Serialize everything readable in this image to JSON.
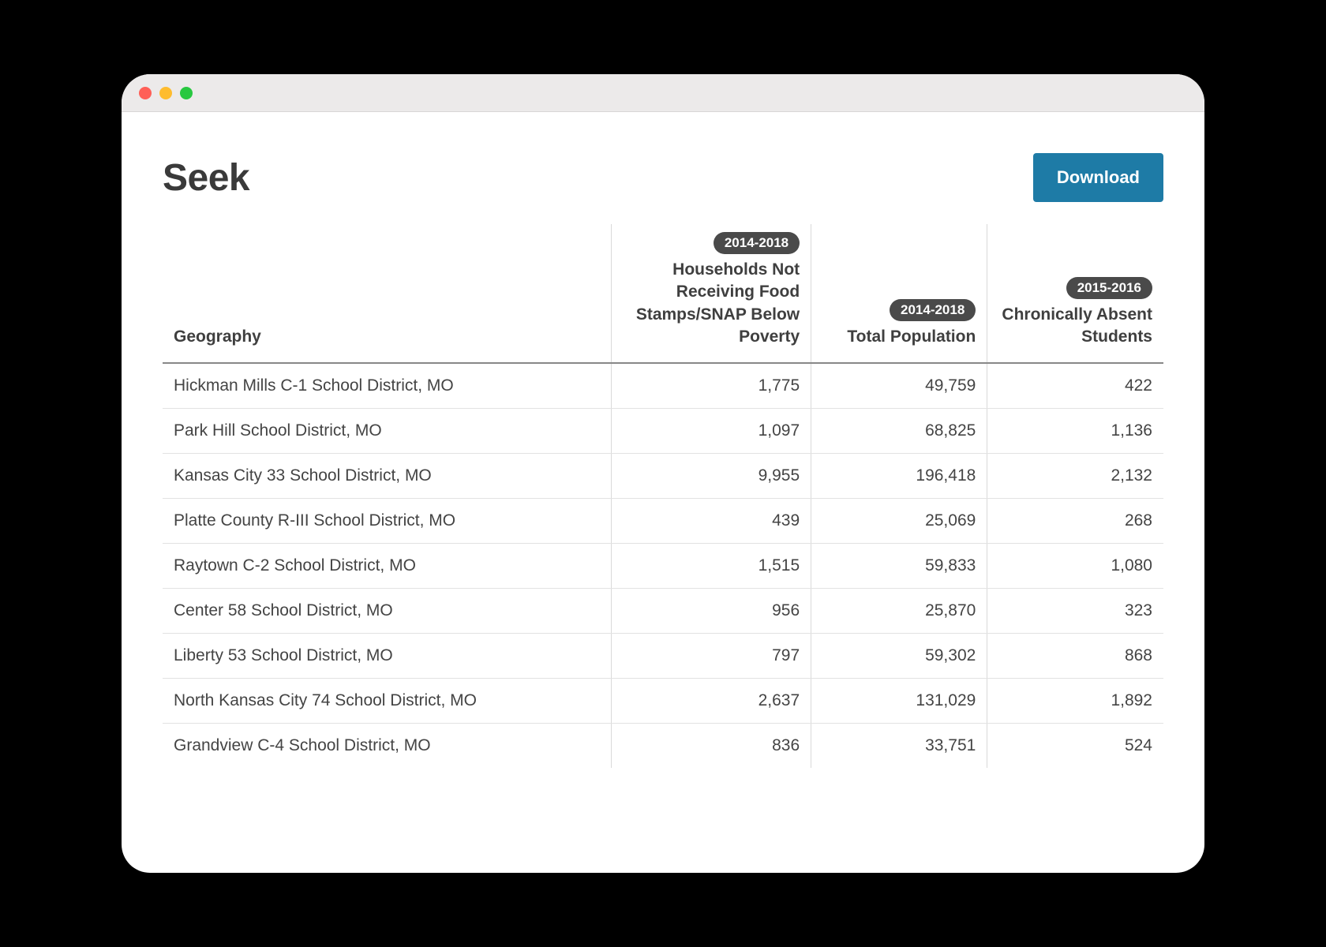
{
  "page_title": "Seek",
  "download_label": "Download",
  "columns": [
    {
      "key": "geo",
      "year": null,
      "label": "Geography",
      "align": "left"
    },
    {
      "key": "snap",
      "year": "2014-2018",
      "label": "Households Not Receiving Food Stamps/SNAP Below Poverty",
      "align": "right"
    },
    {
      "key": "pop",
      "year": "2014-2018",
      "label": "Total Population",
      "align": "right"
    },
    {
      "key": "absent",
      "year": "2015-2016",
      "label": "Chronically Absent Students",
      "align": "right"
    }
  ],
  "rows": [
    {
      "geo": "Hickman Mills C-1 School District, MO",
      "snap": "1,775",
      "pop": "49,759",
      "absent": "422"
    },
    {
      "geo": "Park Hill School District, MO",
      "snap": "1,097",
      "pop": "68,825",
      "absent": "1,136"
    },
    {
      "geo": "Kansas City 33 School District, MO",
      "snap": "9,955",
      "pop": "196,418",
      "absent": "2,132"
    },
    {
      "geo": "Platte County R-III School District, MO",
      "snap": "439",
      "pop": "25,069",
      "absent": "268"
    },
    {
      "geo": "Raytown C-2 School District, MO",
      "snap": "1,515",
      "pop": "59,833",
      "absent": "1,080"
    },
    {
      "geo": "Center 58 School District, MO",
      "snap": "956",
      "pop": "25,870",
      "absent": "323"
    },
    {
      "geo": "Liberty 53 School District, MO",
      "snap": "797",
      "pop": "59,302",
      "absent": "868"
    },
    {
      "geo": "North Kansas City 74 School District, MO",
      "snap": "2,637",
      "pop": "131,029",
      "absent": "1,892"
    },
    {
      "geo": "Grandview C-4 School District, MO",
      "snap": "836",
      "pop": "33,751",
      "absent": "524"
    }
  ]
}
